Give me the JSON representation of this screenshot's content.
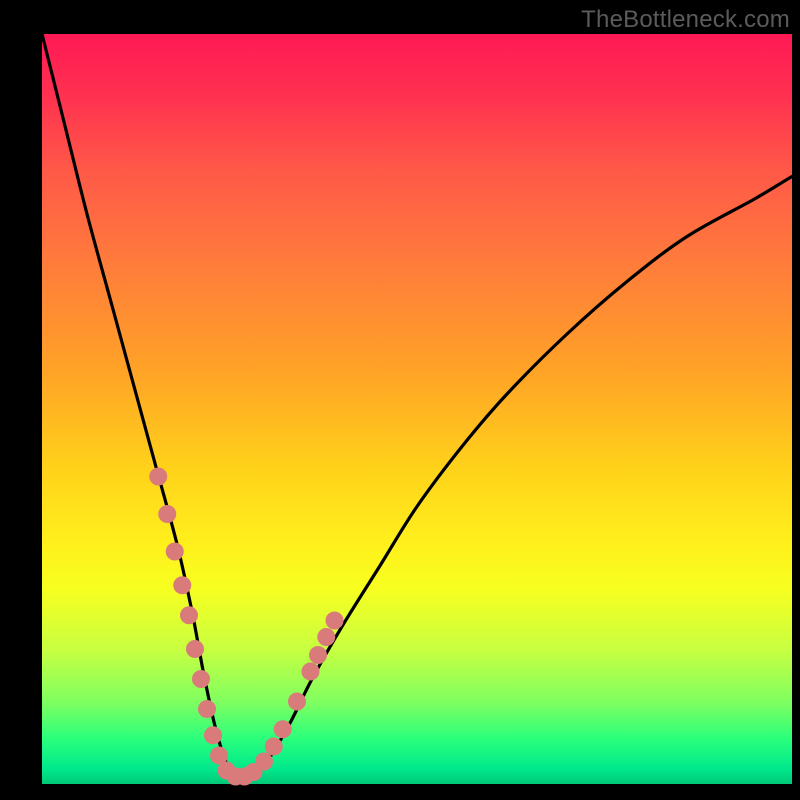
{
  "watermark": "TheBottleneck.com",
  "chart_data": {
    "type": "line",
    "title": "",
    "xlabel": "",
    "ylabel": "",
    "xlim": [
      0,
      100
    ],
    "ylim": [
      0,
      100
    ],
    "grid": false,
    "legend": false,
    "series": [
      {
        "name": "bottleneck-curve",
        "x": [
          0,
          3,
          6,
          9,
          12,
          15,
          18,
          20,
          21.5,
          23,
          24.5,
          26,
          28,
          30,
          33,
          36,
          40,
          45,
          50,
          56,
          62,
          70,
          78,
          86,
          95,
          100,
          102
        ],
        "y": [
          100,
          88,
          76,
          65,
          54,
          43,
          32,
          23,
          15,
          8,
          3,
          1,
          1,
          3,
          8,
          14,
          21,
          29,
          37,
          45,
          52,
          60,
          67,
          73,
          78,
          81,
          82
        ]
      }
    ],
    "markers": {
      "name": "highlight-dots",
      "color": "#d97b7b",
      "radius_px": 9,
      "points": [
        {
          "x": 15.5,
          "y": 41
        },
        {
          "x": 16.7,
          "y": 36
        },
        {
          "x": 17.7,
          "y": 31
        },
        {
          "x": 18.7,
          "y": 26.5
        },
        {
          "x": 19.6,
          "y": 22.5
        },
        {
          "x": 20.4,
          "y": 18
        },
        {
          "x": 21.2,
          "y": 14
        },
        {
          "x": 22.0,
          "y": 10
        },
        {
          "x": 22.8,
          "y": 6.5
        },
        {
          "x": 23.6,
          "y": 3.8
        },
        {
          "x": 24.6,
          "y": 1.8
        },
        {
          "x": 25.8,
          "y": 1.0
        },
        {
          "x": 27.0,
          "y": 1.0
        },
        {
          "x": 28.2,
          "y": 1.6
        },
        {
          "x": 29.6,
          "y": 3.0
        },
        {
          "x": 30.9,
          "y": 5.0
        },
        {
          "x": 32.1,
          "y": 7.3
        },
        {
          "x": 34.0,
          "y": 11.0
        },
        {
          "x": 35.8,
          "y": 15.0
        },
        {
          "x": 36.8,
          "y": 17.2
        },
        {
          "x": 37.9,
          "y": 19.6
        },
        {
          "x": 39.0,
          "y": 21.8
        }
      ]
    }
  }
}
